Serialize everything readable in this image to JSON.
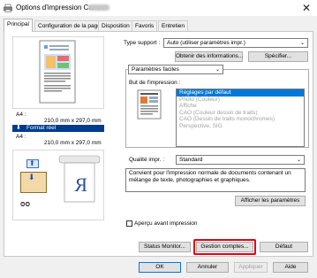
{
  "window": {
    "title": "Options d'impression Canon"
  },
  "tabs": [
    {
      "label": "Principal",
      "active": true
    },
    {
      "label": "Configuration de la page",
      "active": false
    },
    {
      "label": "Disposition",
      "active": false
    },
    {
      "label": "Favoris",
      "active": false
    },
    {
      "label": "Entretien",
      "active": false
    }
  ],
  "preview": {
    "paper_label_1": "A4 :",
    "paper_size_1": "210,0 mm x 297,0 mm",
    "format_label": "Format réel",
    "paper_label_2": "A4 :",
    "paper_size_2": "210,0 mm x 297,0 mm"
  },
  "media": {
    "label": "Type support :",
    "value": "Auto (utiliser paramètres impr.)",
    "info_button": "Obtenir des informations...",
    "specify_button": "Spécifier..."
  },
  "settings_mode": {
    "value": "Paramètres faciles"
  },
  "purpose": {
    "label": "But de l'impression :",
    "items": [
      {
        "label": "Réglages par défaut",
        "state": "selected"
      },
      {
        "label": "Photo (Couleur)",
        "state": "disabled"
      },
      {
        "label": "Affiche",
        "state": "disabled"
      },
      {
        "label": "CAO (Couleur dessin de traits)",
        "state": "disabled"
      },
      {
        "label": "CAO (Dessin de traits monochromes)",
        "state": "disabled"
      },
      {
        "label": "Perspective, SIG",
        "state": "disabled"
      }
    ]
  },
  "quality": {
    "label": "Qualité impr. :",
    "value": "Standard",
    "description": "Convient pour l'impression normale de documents contenant un mélange de texte, photographies et graphiques.",
    "show_settings_button": "Afficher les paramètres"
  },
  "preview_checkbox": {
    "label": "Aperçu avant impression",
    "checked": false
  },
  "bottom_buttons": {
    "status_monitor": "Status Monitor...",
    "manage_accounts": "Gestion comptes...",
    "defaults": "Défaut"
  },
  "dialog_buttons": {
    "ok": "OK",
    "cancel": "Annuler",
    "apply": "Appliquer",
    "help": "Aide"
  },
  "colors": {
    "selection": "#0078d7",
    "highlight": "#e60012",
    "format_bar": "#003b8e"
  }
}
